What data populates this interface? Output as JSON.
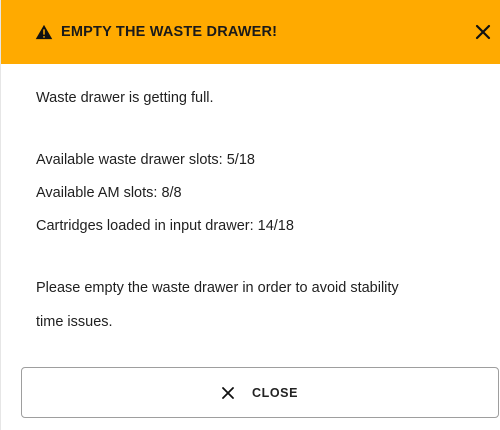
{
  "dialog": {
    "title": "EMPTY THE WASTE DRAWER!",
    "header_color": "#ffaa00",
    "icons": {
      "warning": "warning-triangle-icon",
      "close": "close-icon"
    },
    "body_lines": [
      "Waste drawer is getting full.",
      "Available waste drawer slots: 5/18",
      "Available AM slots: 8/8",
      "Cartridges loaded in input drawer: 14/18",
      "Please empty the waste drawer in order to avoid stability",
      "time issues."
    ],
    "button_label": "CLOSE"
  }
}
